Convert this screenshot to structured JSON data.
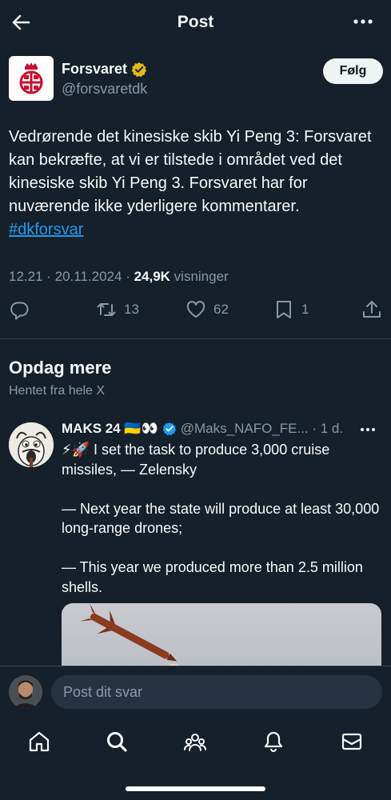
{
  "header": {
    "title": "Post"
  },
  "post": {
    "author_name": "Forsvaret",
    "author_handle": "@forsvaretdk",
    "follow_label": "Følg",
    "text": "Vedrørende det kinesiske skib Yi Peng 3: Forsvaret kan bekræfte, at vi er tilstede i området ved det kinesiske skib Yi Peng 3. Forsvaret har for nuværende ikke yderligere kommentarer. ",
    "hashtag": "#dkforsvar",
    "time": "12.21 · 20.11.2024 · ",
    "views_count": "24,9K",
    "views_label": " visninger",
    "retweets": "13",
    "likes": "62",
    "bookmarks": "1"
  },
  "discover": {
    "title": "Opdag mere",
    "subtitle": "Hentet fra hele X"
  },
  "tweet2": {
    "name": "MAKS 24 🇺🇦👀",
    "handle_time": "@Maks_NAFO_FE... · 1 d.",
    "text": "⚡🚀 I set the task to produce 3,000 cruise missiles, — Zelensky\n\n— Next year the state will produce at least 30,000 long-range drones;\n\n— This year we produced more than 2.5 million shells."
  },
  "reply": {
    "placeholder": "Post dit svar"
  },
  "colors": {
    "background": "#15202b",
    "accent": "#1d9bf0",
    "muted": "#8b98a5",
    "gold": "#e2b719"
  },
  "icons": [
    "back-arrow-icon",
    "more-icon",
    "verified-gold-icon",
    "verified-blue-icon",
    "reply-icon",
    "retweet-icon",
    "like-icon",
    "bookmark-icon",
    "share-icon",
    "home-icon",
    "search-icon",
    "communities-icon",
    "notifications-icon",
    "messages-icon"
  ]
}
